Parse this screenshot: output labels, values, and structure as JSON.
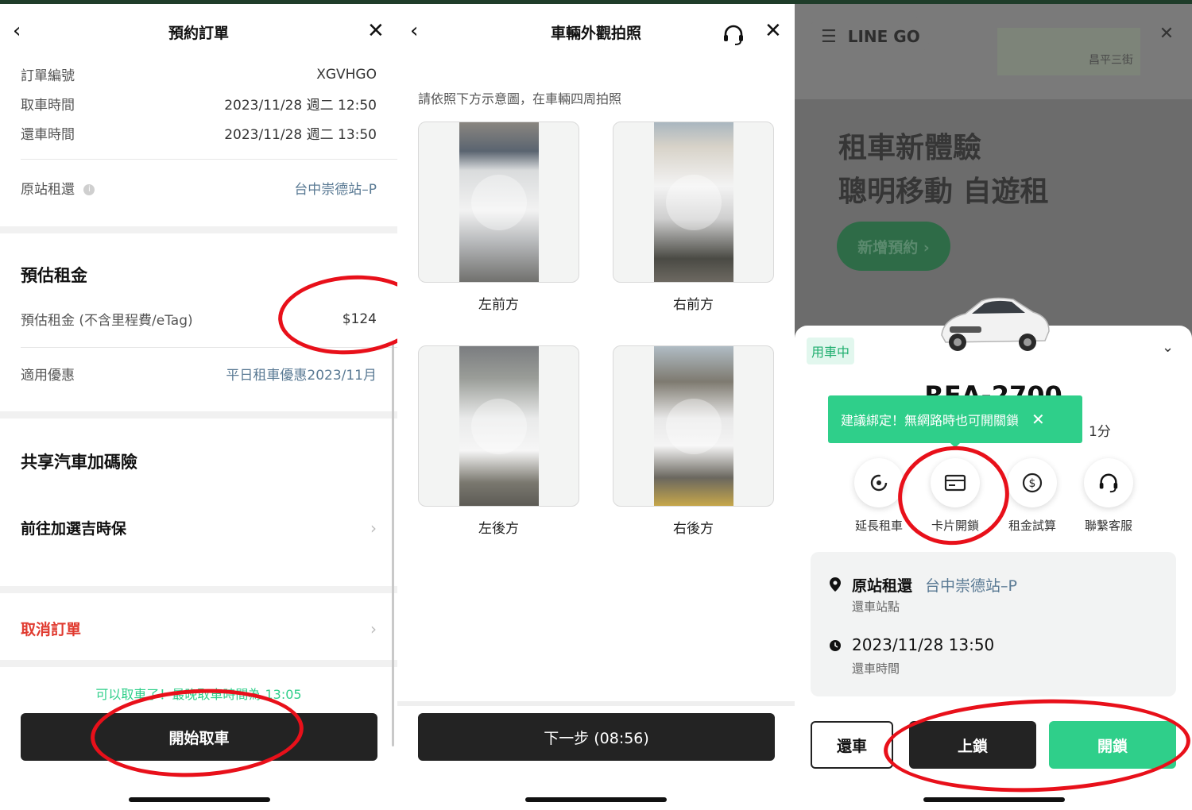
{
  "panel1": {
    "title": "預約訂單",
    "back": "‹",
    "close": "✕",
    "rows": [
      {
        "label": "訂單編號",
        "value": "XGVHGO"
      },
      {
        "label": "取車時間",
        "value": "2023/11/28 週二 12:50"
      },
      {
        "label": "還車時間",
        "value": "2023/11/28 週二 13:50"
      }
    ],
    "station_label": "原站租還",
    "station_value": "台中崇德站–P",
    "fee_title": "預估租金",
    "fee_label": "預估租金 (不含里程費/eTag)",
    "fee_value": "$124",
    "discount_label": "適用優惠",
    "discount_value": "平日租車優惠2023/11月",
    "insurance_title": "共享汽車加碼險",
    "insurance_link": "前往加選吉時保",
    "cancel_label": "取消訂單",
    "notice": "可以取車了！最晚取車時間為 13:05",
    "start_button": "開始取車"
  },
  "panel2": {
    "title": "車輛外觀拍照",
    "back": "‹",
    "close": "✕",
    "instruction": "請依照下方示意圖，在車輛四周拍照",
    "photos": [
      {
        "label": "左前方"
      },
      {
        "label": "右前方"
      },
      {
        "label": "左後方"
      },
      {
        "label": "右後方"
      }
    ],
    "next_button": "下一步 (08:56)"
  },
  "panel3": {
    "brand": "LINE GO",
    "map_text_1": "昌平三街",
    "hero_line1": "租車新體驗",
    "hero_line2": "聰明移動 自遊租",
    "new_booking": "新增預約 ›",
    "status_badge": "用車中",
    "plate": "REA-2700",
    "tooltip": "建議綁定！無網路時也可開關鎖",
    "duration_suffix": "1分",
    "actions": [
      {
        "label": "延長租車",
        "icon": "extend-icon"
      },
      {
        "label": "卡片開鎖",
        "icon": "card-icon"
      },
      {
        "label": "租金試算",
        "icon": "dollar-icon"
      },
      {
        "label": "聯繫客服",
        "icon": "headset-icon"
      }
    ],
    "station_label": "原站租還",
    "station_value": "台中崇德站–P",
    "station_sub": "還車站點",
    "return_time": "2023/11/28 13:50",
    "return_sub": "還車時間",
    "return_button": "還車",
    "lock_button": "上鎖",
    "unlock_button": "開鎖"
  },
  "colors": {
    "accent_green": "#2fcf8a",
    "dark_button": "#232323",
    "link_blue": "#5a7a94",
    "cancel_red": "#e03a2f",
    "highlight_red": "#e8101a"
  }
}
